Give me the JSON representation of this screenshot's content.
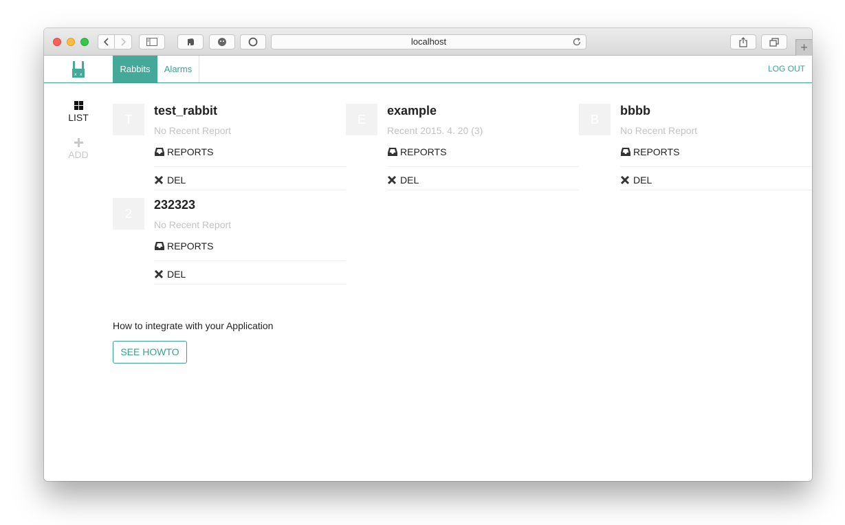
{
  "browser": {
    "url": "localhost"
  },
  "nav": {
    "tabs": [
      {
        "label": "Rabbits",
        "active": true
      },
      {
        "label": "Alarms",
        "active": false
      }
    ],
    "logout_label": "LOG OUT",
    "accent_color": "#45a999"
  },
  "leftnav": {
    "items": [
      {
        "label": "LIST",
        "icon": "grid-icon",
        "active": true
      },
      {
        "label": "ADD",
        "icon": "plus-icon",
        "active": false
      }
    ]
  },
  "rabbits": [
    {
      "initial": "T",
      "name": "test_rabbit",
      "status": "No Recent Report",
      "reports_label": "REPORTS",
      "del_label": "DEL"
    },
    {
      "initial": "E",
      "name": "example",
      "status": "Recent 2015. 4. 20 (3)",
      "reports_label": "REPORTS",
      "del_label": "DEL"
    },
    {
      "initial": "B",
      "name": "bbbb",
      "status": "No Recent Report",
      "reports_label": "REPORTS",
      "del_label": "DEL"
    },
    {
      "initial": "2",
      "name": "232323",
      "status": "No Recent Report",
      "reports_label": "REPORTS",
      "del_label": "DEL"
    }
  ],
  "howto": {
    "text": "How to integrate with your Application",
    "button_label": "SEE HOWTO"
  }
}
